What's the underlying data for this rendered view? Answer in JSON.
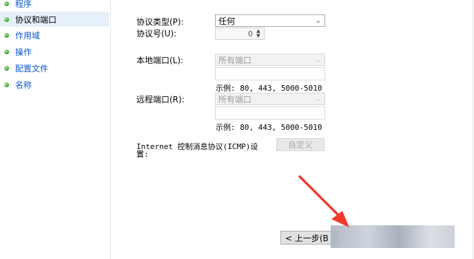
{
  "sidebar": {
    "items": [
      {
        "label": "程序",
        "selected": false
      },
      {
        "label": "协议和端口",
        "selected": true
      },
      {
        "label": "作用域",
        "selected": false
      },
      {
        "label": "操作",
        "selected": false
      },
      {
        "label": "配置文件",
        "selected": false
      },
      {
        "label": "名称",
        "selected": false
      }
    ]
  },
  "form": {
    "protocol_type_label": "协议类型(P):",
    "protocol_type_value": "任何",
    "protocol_number_label": "协议号(U):",
    "protocol_number_value": "0",
    "local_port_label": "本地端口(L):",
    "local_port_value": "所有端口",
    "local_port_example": "示例: 80, 443, 5000-5010",
    "remote_port_label": "远程端口(R):",
    "remote_port_value": "所有端口",
    "remote_port_example": "示例: 80, 443, 5000-5010",
    "icmp_label_line1": "Internet 控制消息协议(ICMP)设",
    "icmp_label_line2": "置:",
    "customize_button": "自定义"
  },
  "footer": {
    "back_button": "< 上一步(B"
  },
  "colors": {
    "nav_link": "#0b57d0",
    "selected_row": "#e5f0fa",
    "annotation_arrow": "#f03a2e"
  }
}
